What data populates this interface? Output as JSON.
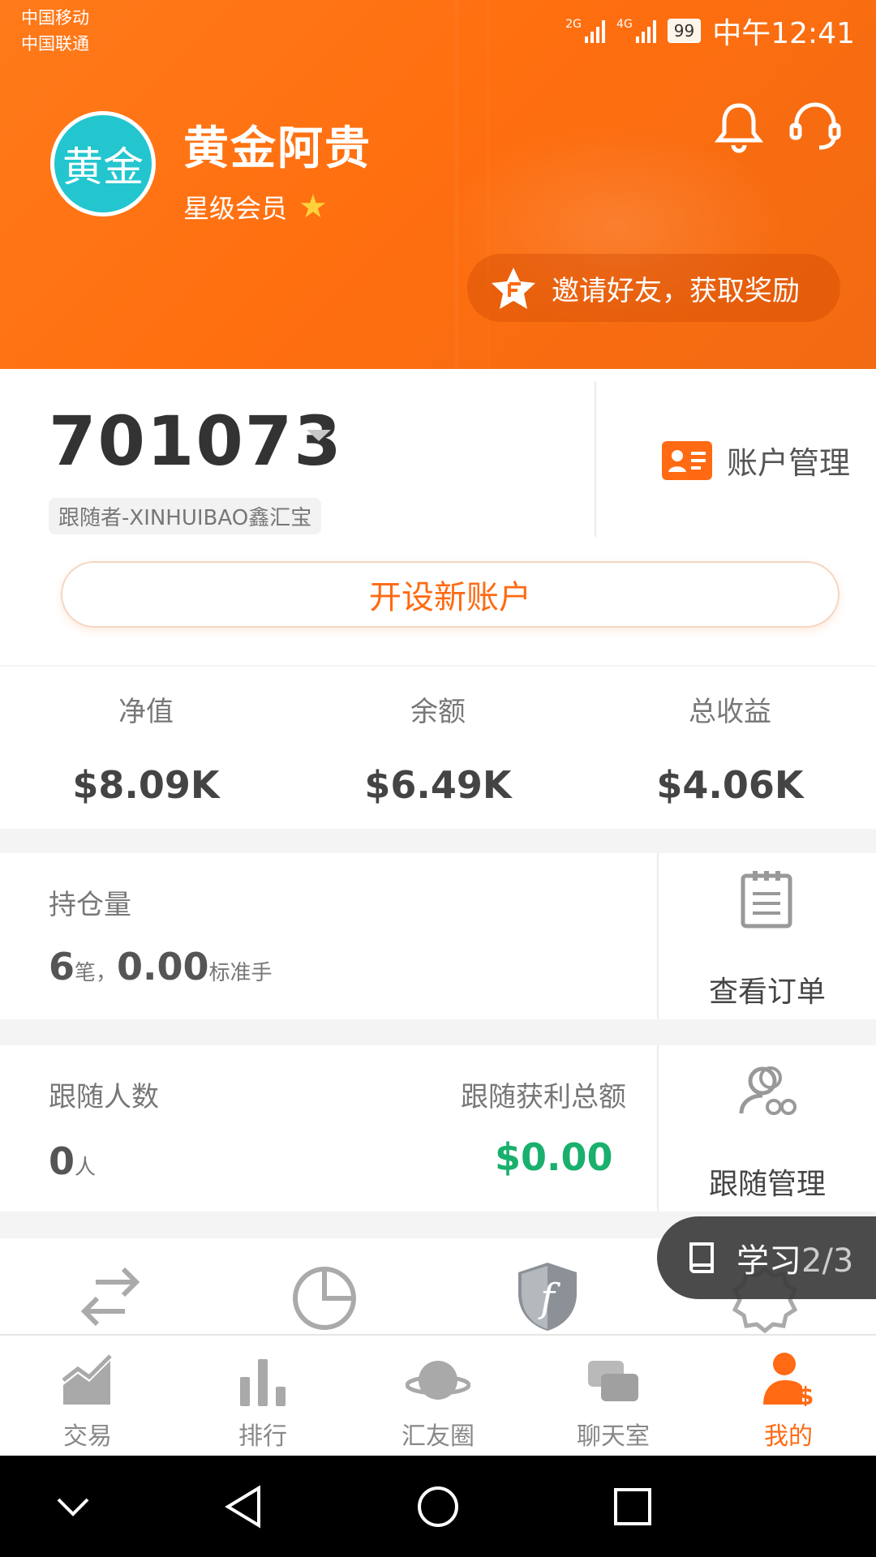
{
  "status_bar": {
    "carrier1": "中国移动",
    "carrier2": "中国联通",
    "net1": "2G",
    "net2": "4G",
    "battery": "99",
    "time": "中午12:41"
  },
  "profile": {
    "avatar_text": "黄金",
    "name": "黄金阿贵",
    "level": "星级会员",
    "invite_label": "邀请好友，获取奖励"
  },
  "account": {
    "number": "701073",
    "subtitle": "跟随者-XINHUIBAO鑫汇宝",
    "manage_label": "账户管理",
    "open_button": "开设新账户"
  },
  "stats": [
    {
      "label": "净值",
      "value": "$8.09K"
    },
    {
      "label": "余额",
      "value": "$6.49K"
    },
    {
      "label": "总收益",
      "value": "$4.06K"
    }
  ],
  "positions": {
    "label": "持仓量",
    "count": "6",
    "count_unit": "笔，",
    "lots": "0.00",
    "lots_unit": "标准手",
    "side_label": "查看订单"
  },
  "followers": {
    "label": "跟随人数",
    "count": "0",
    "count_unit": "人",
    "profit_label": "跟随获利总额",
    "profit_value": "$0.00",
    "side_label": "跟随管理"
  },
  "learn": {
    "label": "学习",
    "progress": "2/3"
  },
  "tabs": [
    {
      "label": "交易",
      "icon": "trade-chart-icon"
    },
    {
      "label": "排行",
      "icon": "bar-chart-icon"
    },
    {
      "label": "汇友圈",
      "icon": "planet-icon"
    },
    {
      "label": "聊天室",
      "icon": "chat-icon"
    },
    {
      "label": "我的",
      "icon": "user-dollar-icon",
      "active": true
    }
  ],
  "colors": {
    "accent": "#ff6a13",
    "green": "#19b06d",
    "avatar": "#23c6cf"
  }
}
